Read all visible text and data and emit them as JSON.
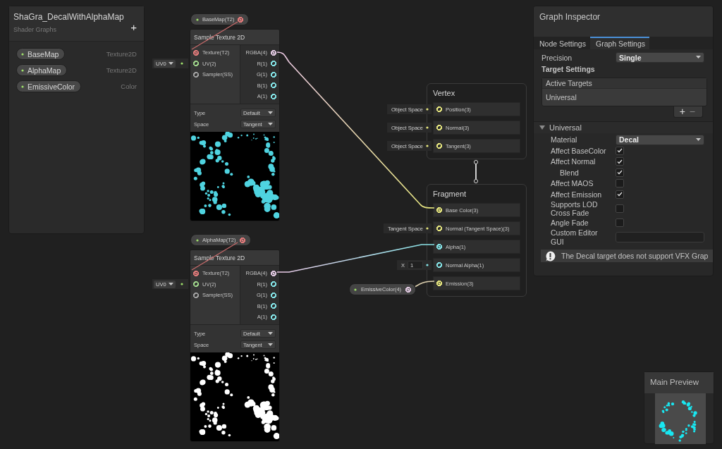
{
  "blackboard": {
    "title": "ShaGra_DecalWithAlphaMap",
    "subtitle": "Shader Graphs",
    "add_button": "+",
    "properties": [
      {
        "name": "BaseMap",
        "type": "Texture2D"
      },
      {
        "name": "AlphaMap",
        "type": "Texture2D"
      },
      {
        "name": "EmissiveColor",
        "type": "Color"
      }
    ]
  },
  "sample_nodes": [
    {
      "property_label": "BaseMap(T2)",
      "title": "Sample Texture 2D",
      "uv_input": "UV0",
      "color": "#4fd3e0",
      "inputs": [
        {
          "label": "Texture(T2)",
          "color": "#e07a7a",
          "connected": true
        },
        {
          "label": "UV(2)",
          "color": "#9ed48a",
          "connected": false
        },
        {
          "label": "Sampler(SS)",
          "color": "#a0a0a0",
          "connected": false
        }
      ],
      "outputs": [
        {
          "label": "RGBA(4)",
          "color": "#e0c8e0",
          "connected": true
        },
        {
          "label": "R(1)",
          "color": "#84e4e7",
          "connected": false
        },
        {
          "label": "G(1)",
          "color": "#84e4e7",
          "connected": false
        },
        {
          "label": "B(1)",
          "color": "#84e4e7",
          "connected": false
        },
        {
          "label": "A(1)",
          "color": "#84e4e7",
          "connected": false
        }
      ],
      "settings": [
        {
          "label": "Type",
          "value": "Default"
        },
        {
          "label": "Space",
          "value": "Tangent"
        }
      ]
    },
    {
      "property_label": "AlphaMap(T2)",
      "title": "Sample Texture 2D",
      "uv_input": "UV0",
      "color": "#ffffff",
      "inputs": [
        {
          "label": "Texture(T2)",
          "color": "#e07a7a",
          "connected": true
        },
        {
          "label": "UV(2)",
          "color": "#9ed48a",
          "connected": false
        },
        {
          "label": "Sampler(SS)",
          "color": "#a0a0a0",
          "connected": false
        }
      ],
      "outputs": [
        {
          "label": "RGBA(4)",
          "color": "#e0c8e0",
          "connected": true
        },
        {
          "label": "R(1)",
          "color": "#84e4e7",
          "connected": false
        },
        {
          "label": "G(1)",
          "color": "#84e4e7",
          "connected": false
        },
        {
          "label": "B(1)",
          "color": "#84e4e7",
          "connected": false
        },
        {
          "label": "A(1)",
          "color": "#84e4e7",
          "connected": false
        }
      ],
      "settings": [
        {
          "label": "Type",
          "value": "Default"
        },
        {
          "label": "Space",
          "value": "Tangent"
        }
      ]
    }
  ],
  "master_stack": {
    "vertex": {
      "title": "Vertex",
      "blocks": [
        {
          "label": "Position(3)",
          "color": "#e6e67e",
          "connected": false,
          "input": "Object Space"
        },
        {
          "label": "Normal(3)",
          "color": "#e6e67e",
          "connected": false,
          "input": "Object Space"
        },
        {
          "label": "Tangent(3)",
          "color": "#e6e67e",
          "connected": false,
          "input": "Object Space"
        }
      ]
    },
    "fragment": {
      "title": "Fragment",
      "blocks": [
        {
          "label": "Base Color(3)",
          "color": "#e6e67e",
          "connected": true
        },
        {
          "label": "Normal (Tangent Space)(3)",
          "color": "#e6e67e",
          "connected": false,
          "input": "Tangent Space"
        },
        {
          "label": "Alpha(1)",
          "color": "#84e4e7",
          "connected": true
        },
        {
          "label": "Normal Alpha(1)",
          "color": "#84e4e7",
          "connected": false,
          "field": {
            "axis": "X",
            "value": "1"
          }
        },
        {
          "label": "Emission(3)",
          "color": "#e6e67e",
          "connected": true
        }
      ]
    }
  },
  "emissive_node": {
    "label": "EmissiveColor(4)"
  },
  "inspector": {
    "title": "Graph Inspector",
    "tabs": [
      {
        "label": "Node Settings",
        "selected": false
      },
      {
        "label": "Graph Settings",
        "selected": true
      }
    ],
    "precision": {
      "label": "Precision",
      "value": "Single"
    },
    "target_settings": "Target Settings",
    "active_targets": {
      "header": "Active Targets",
      "items": [
        "Universal"
      ],
      "add_button": "+",
      "remove_button": "−"
    },
    "section": {
      "title": "Universal",
      "expanded": true,
      "rows": [
        {
          "kind": "dropdown",
          "label": "Material",
          "value": "Decal"
        },
        {
          "kind": "toggle",
          "label": "Affect BaseColor",
          "checked": true
        },
        {
          "kind": "toggle",
          "label": "Affect Normal",
          "checked": true,
          "children": [
            {
              "kind": "toggle",
              "label": "Blend",
              "checked": true
            }
          ]
        },
        {
          "kind": "toggle",
          "label": "Affect MAOS",
          "checked": false
        },
        {
          "kind": "toggle",
          "label": "Affect Emission",
          "checked": true
        },
        {
          "kind": "toggle",
          "label": "Supports LOD Cross Fade",
          "checked": false
        },
        {
          "kind": "toggle",
          "label": "Angle Fade",
          "checked": false
        },
        {
          "kind": "text",
          "label": "Custom Editor GUI"
        }
      ]
    },
    "warning": "The Decal target does not support VFX Grap"
  },
  "main_preview": {
    "title": "Main Preview"
  }
}
